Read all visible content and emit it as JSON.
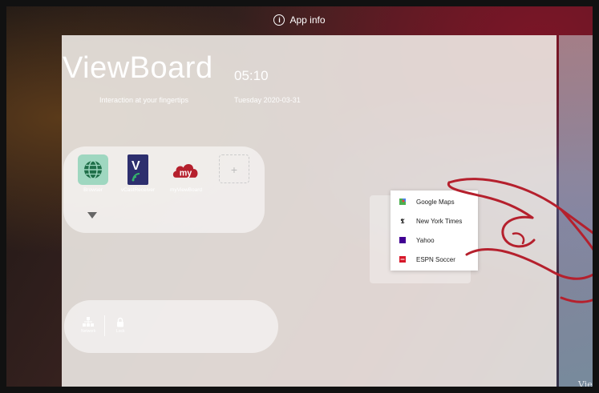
{
  "topbar": {
    "app_info_label": "App info"
  },
  "header": {
    "brand": "ViewBoard",
    "time": "05:10",
    "tagline": "Interaction at your fingertips",
    "date": "Tuesday 2020-03-31"
  },
  "dock": {
    "apps": [
      {
        "label": "Browser",
        "icon": "globe-icon"
      },
      {
        "label": "vCastReceiver",
        "icon": "vcast-icon"
      },
      {
        "label": "myViewBoard",
        "icon": "myviewboard-icon"
      }
    ],
    "add_label": "+"
  },
  "tools": [
    {
      "label": "Network",
      "icon": "network-icon"
    },
    {
      "label": "Lock",
      "icon": "lock-icon"
    }
  ],
  "context_menu": {
    "items": [
      {
        "label": "Google Maps",
        "icon": "google-maps-icon",
        "color": "#34a853"
      },
      {
        "label": "New York Times",
        "icon": "nyt-icon",
        "color": "#000000"
      },
      {
        "label": "Yahoo",
        "icon": "yahoo-icon",
        "color": "#410093"
      },
      {
        "label": "ESPN Soccer",
        "icon": "espn-icon",
        "color": "#d7182a"
      }
    ]
  },
  "right_strip_text": "Vie",
  "colors": {
    "accent_red": "#b5202d",
    "browser_green": "#2e7d4f",
    "vcast_navy": "#2d2f6e"
  }
}
